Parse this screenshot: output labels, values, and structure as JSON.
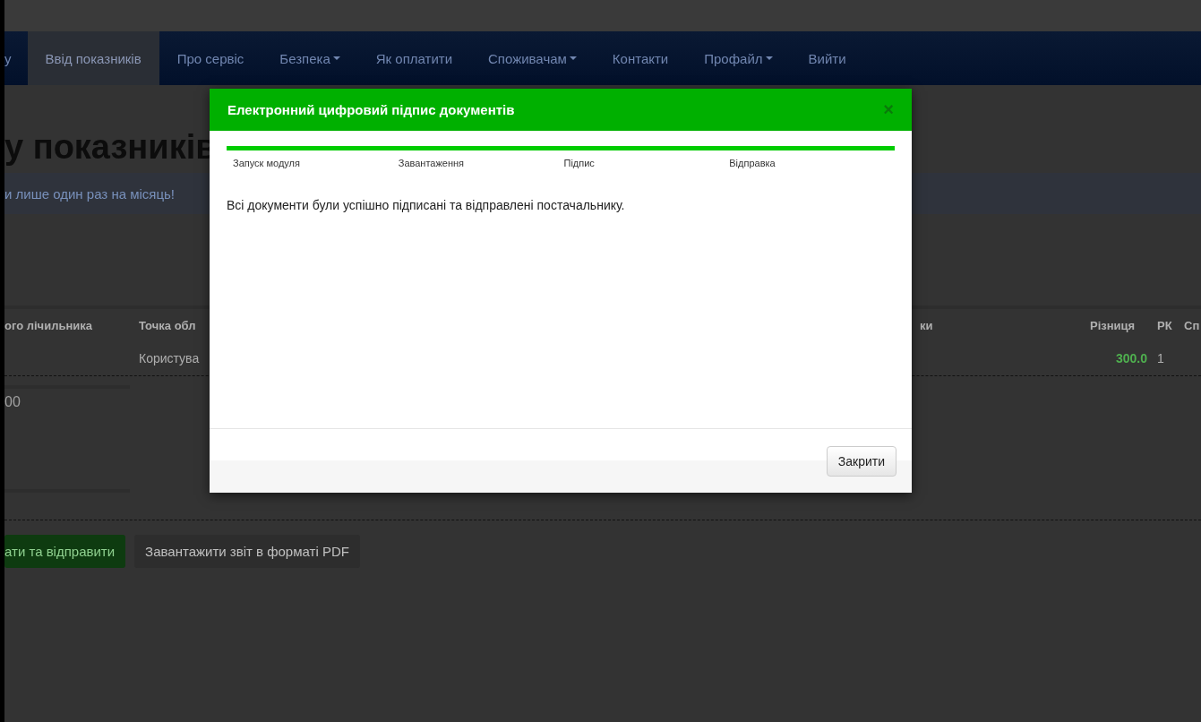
{
  "top_nav": {
    "items": [
      {
        "label": "у",
        "selected": false,
        "dropdown": false
      },
      {
        "label": "Ввід показників",
        "selected": true,
        "dropdown": false
      },
      {
        "label": "Про сервіс",
        "selected": false,
        "dropdown": false
      },
      {
        "label": "Безпека",
        "selected": false,
        "dropdown": true
      },
      {
        "label": "Як оплатити",
        "selected": false,
        "dropdown": false
      },
      {
        "label": "Споживачам",
        "selected": false,
        "dropdown": true
      },
      {
        "label": "Контакти",
        "selected": false,
        "dropdown": false
      },
      {
        "label": "Профайл",
        "selected": false,
        "dropdown": true
      },
      {
        "label": "Вийти",
        "selected": false,
        "dropdown": false
      }
    ]
  },
  "page": {
    "heading": "у показників",
    "notice": "и лише один раз на місяць!",
    "table": {
      "columns": [
        "ого лічильника",
        "Точка обл",
        "ки",
        "Різниця",
        "РК",
        "Сп"
      ],
      "rows": [
        {
          "point": "Користува",
          "difference": "300.0",
          "rk": "1"
        }
      ]
    },
    "summary_value": "00",
    "buttons": [
      {
        "label": "ати та відправити",
        "kind": "primary"
      },
      {
        "label": "Завантажити звіт в форматі PDF",
        "kind": "default"
      }
    ]
  },
  "modal": {
    "title": "Електронний цифровий підпис документів",
    "close": "×",
    "progress": {
      "level": 1
    },
    "steps": [
      "Запуск модуля",
      "Завантаження",
      "Підпис",
      "Відправка"
    ],
    "message": "Всі документи були успішно підписані та відправлені постачальнику.",
    "button": "Закрити"
  }
}
